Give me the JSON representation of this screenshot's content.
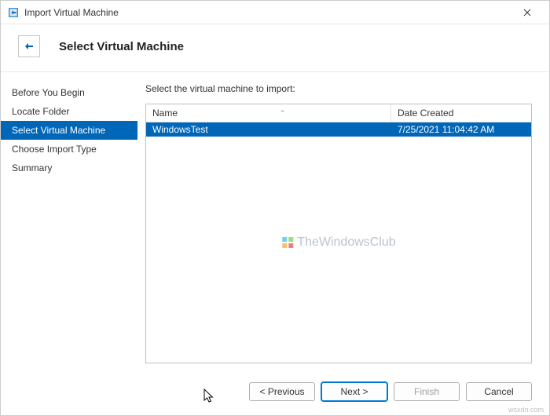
{
  "window": {
    "title": "Import Virtual Machine"
  },
  "header": {
    "title": "Select Virtual Machine"
  },
  "sidebar": {
    "items": [
      {
        "label": "Before You Begin",
        "active": false
      },
      {
        "label": "Locate Folder",
        "active": false
      },
      {
        "label": "Select Virtual Machine",
        "active": true
      },
      {
        "label": "Choose Import Type",
        "active": false
      },
      {
        "label": "Summary",
        "active": false
      }
    ]
  },
  "main": {
    "instruction": "Select the virtual machine to import:",
    "columns": {
      "name": "Name",
      "date": "Date Created"
    },
    "rows": [
      {
        "name": "WindowsTest",
        "date": "7/25/2021 11:04:42 AM",
        "selected": true
      }
    ]
  },
  "watermark": "TheWindowsClub",
  "footer": {
    "previous": "< Previous",
    "next": "Next >",
    "finish": "Finish",
    "cancel": "Cancel"
  },
  "attribution": "wsxdn.com"
}
